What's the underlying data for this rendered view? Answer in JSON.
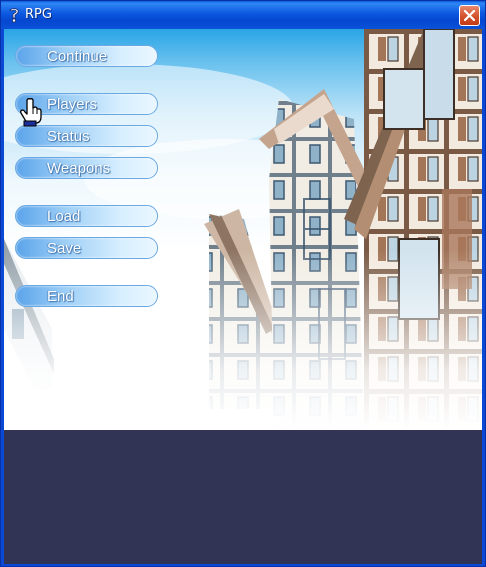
{
  "window": {
    "title": "RPG"
  },
  "menu": {
    "items": [
      {
        "id": "continue",
        "label": "Continue"
      },
      {
        "id": "players",
        "label": "Players"
      },
      {
        "id": "status",
        "label": "Status"
      },
      {
        "id": "weapons",
        "label": "Weapons"
      },
      {
        "id": "load",
        "label": "Load"
      },
      {
        "id": "save",
        "label": "Save"
      },
      {
        "id": "end",
        "label": "End"
      }
    ]
  },
  "icons": {
    "cursor": "pointing-hand-icon",
    "close": "close-icon",
    "app": "app-icon"
  },
  "colors": {
    "titlebar": "#0a52d9",
    "close": "#d3512d",
    "button": "#9ecff6",
    "bottom": "#323455"
  }
}
